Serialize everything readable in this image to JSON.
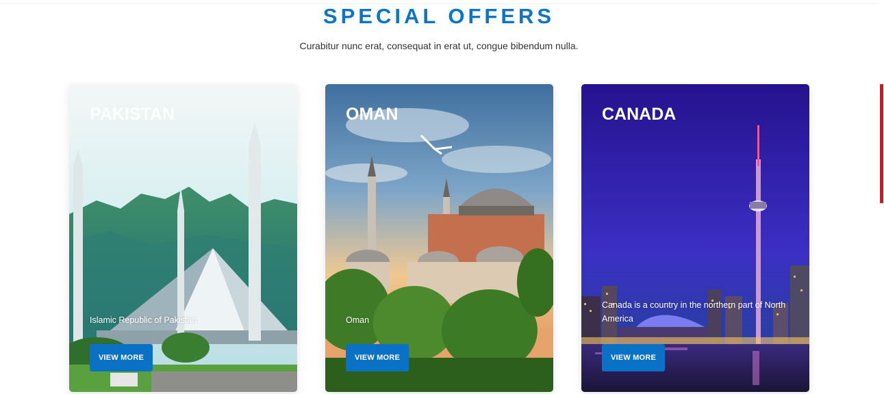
{
  "section": {
    "title": "SPECIAL OFFERS",
    "subtitle": "Curabitur nunc erat, consequat in erat ut, congue bibendum nulla."
  },
  "offers": [
    {
      "title": "PAKISTAN",
      "description": "Islamic Republic of Pakistan",
      "button_label": "VIEW MORE"
    },
    {
      "title": "OMAN",
      "description": "Oman",
      "button_label": "VIEW MORE"
    },
    {
      "title": "CANADA",
      "description": "Canada is a country in the northern part of North America",
      "button_label": "VIEW MORE"
    }
  ],
  "colors": {
    "accent": "#0a75c9",
    "button": "#0a72c6",
    "scroll_indicator": "#d8141c"
  }
}
